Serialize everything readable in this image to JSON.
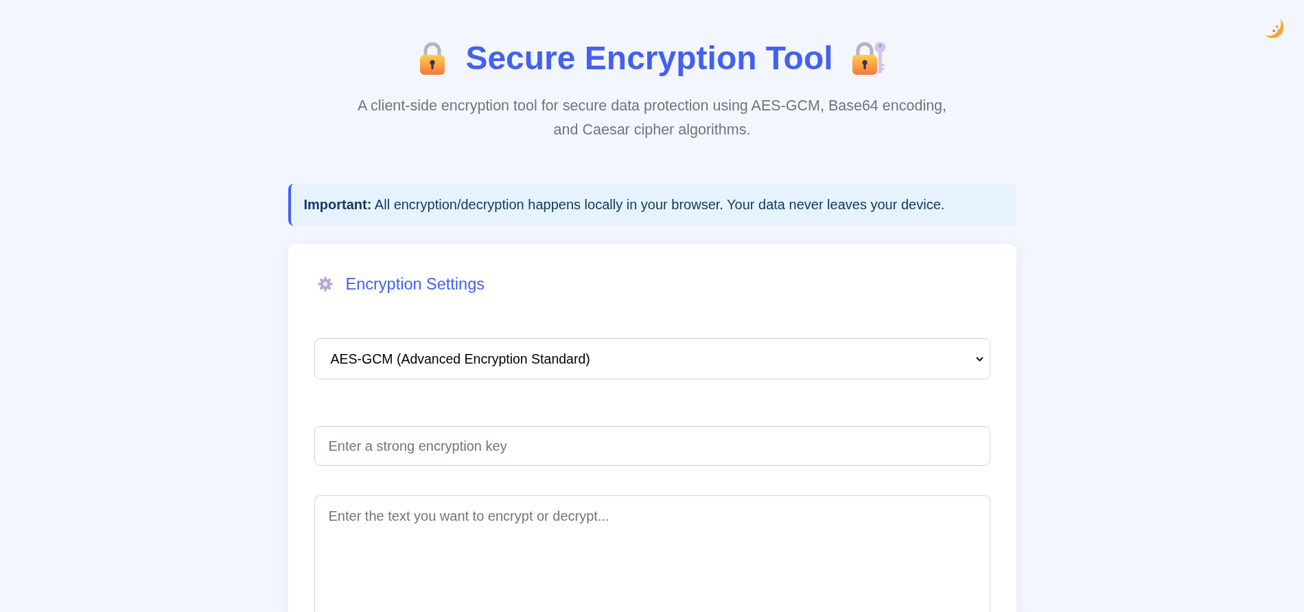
{
  "header": {
    "title": "Secure Encryption Tool",
    "subtitle": "A client-side encryption tool for secure data protection using AES-GCM, Base64 encoding, and Caesar cipher algorithms."
  },
  "notice": {
    "text": "**Important:** All encryption/decryption happens locally in your browser. Your data never leaves your device."
  },
  "settings_card": {
    "title": "Encryption Settings",
    "algorithm_select": {
      "value": "AES-GCM (Advanced Encryption Standard)"
    },
    "key_field": {
      "placeholder": "Enter a strong encryption key"
    },
    "text_field": {
      "placeholder": "Enter the text you want to encrypt or decrypt..."
    }
  }
}
